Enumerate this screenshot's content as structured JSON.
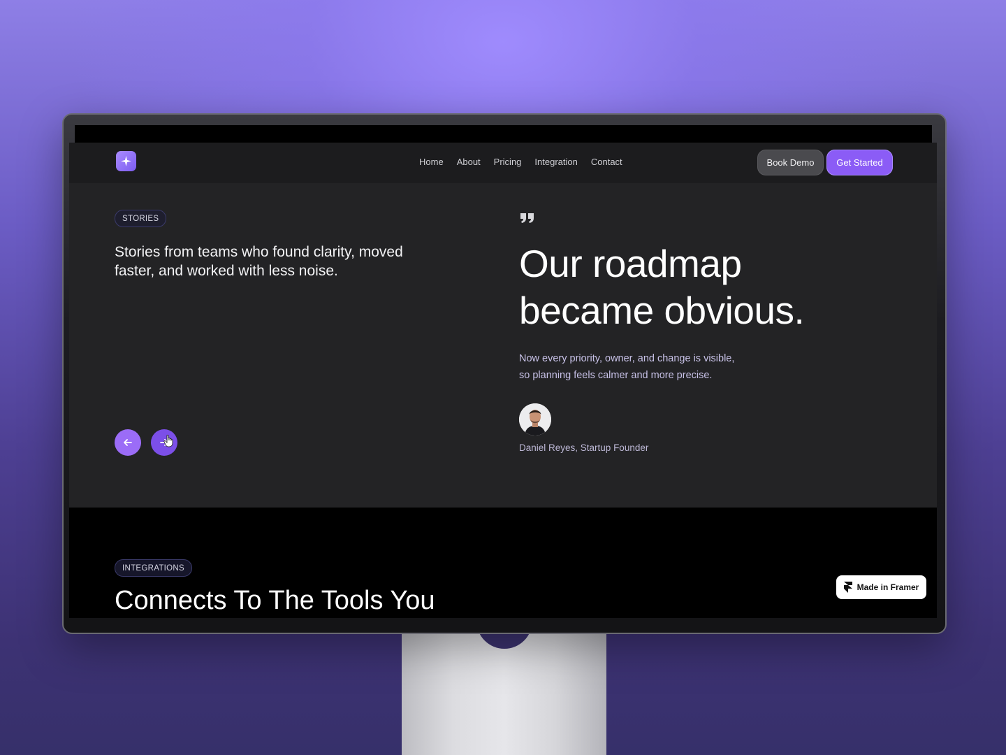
{
  "nav": {
    "links": [
      "Home",
      "About",
      "Pricing",
      "Integration",
      "Contact"
    ],
    "book_demo": "Book Demo",
    "get_started": "Get Started"
  },
  "stories": {
    "badge": "STORIES",
    "intro": "Stories from teams who found clarity, moved faster, and worked with less noise."
  },
  "testimonial": {
    "headline_line1": "Our roadmap",
    "headline_line2": "became obvious.",
    "subtext_line1": "Now every priority, owner, and change is visible,",
    "subtext_line2": "so planning feels calmer and more precise.",
    "author": "Daniel Reyes, Startup Founder"
  },
  "integrations": {
    "badge": "INTEGRATIONS",
    "title": "Connects To The Tools You"
  },
  "framer_badge": "Made in Framer",
  "colors": {
    "accent": "#8b5cf6",
    "background": "#232325",
    "nav_bg": "#1c1c1e"
  },
  "icons": {
    "logo": "sparkle-icon",
    "prev": "arrow-left-icon",
    "next": "arrow-right-icon",
    "quote": "quote-icon",
    "framer": "framer-logo-icon"
  }
}
